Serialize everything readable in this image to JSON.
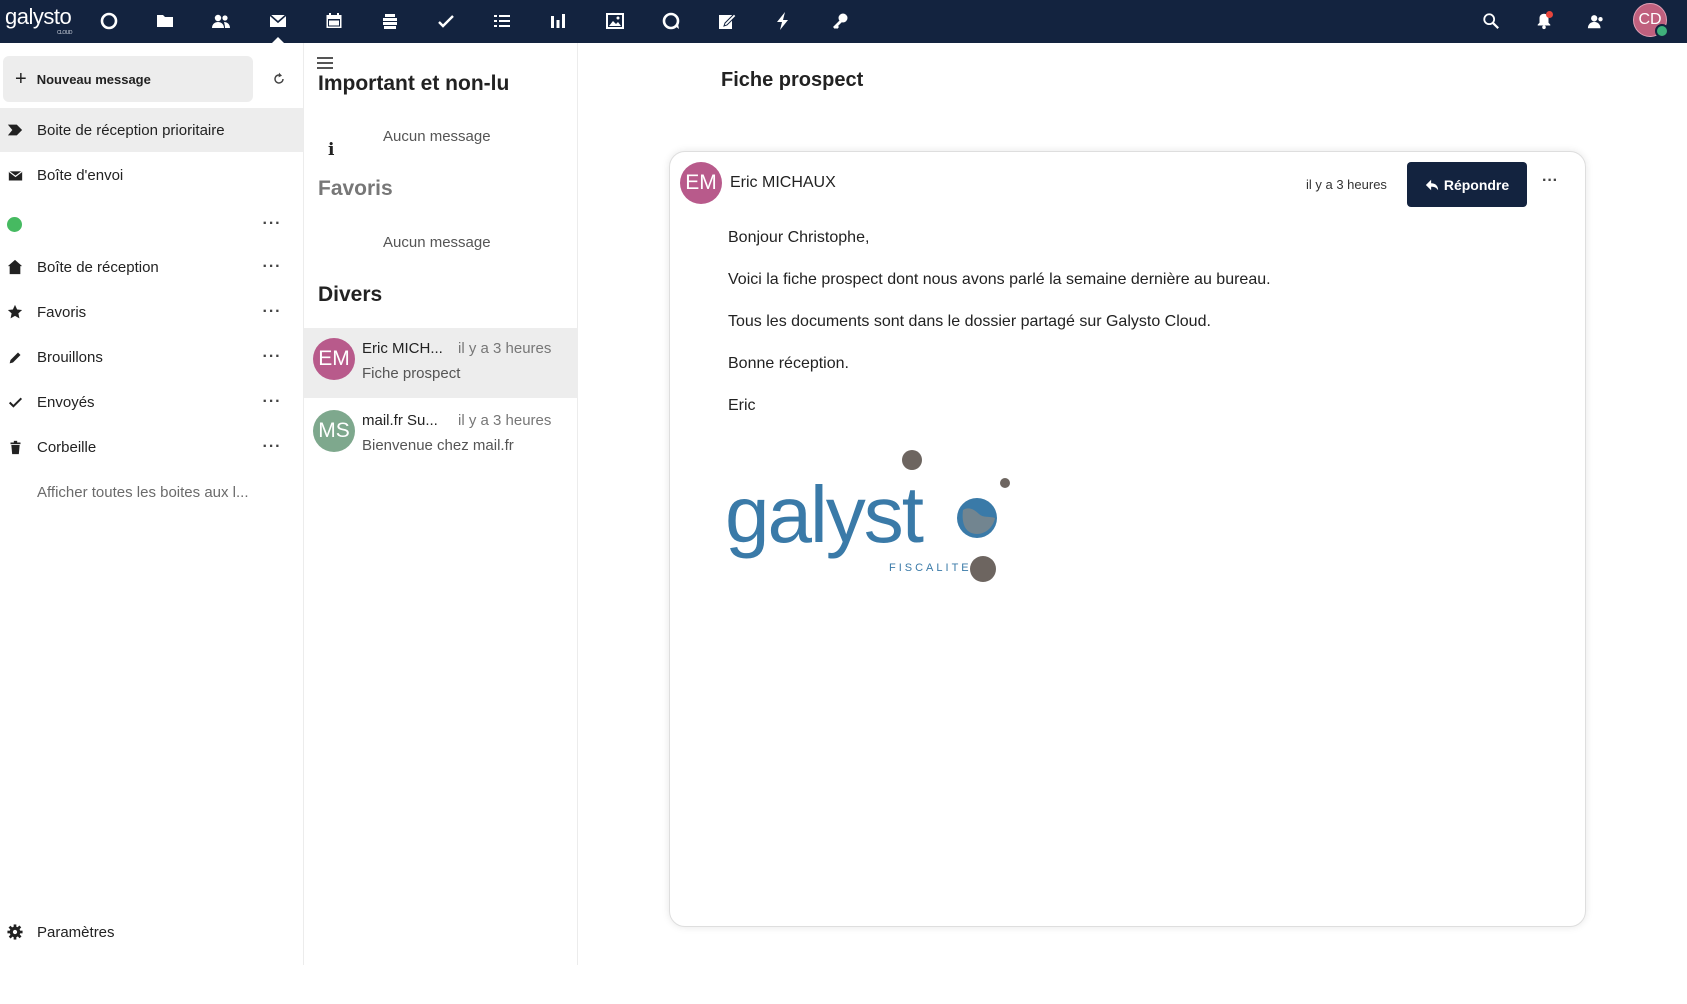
{
  "topbar": {
    "brand": "galysto",
    "brand_sub": "CLOUD",
    "apps": [
      {
        "icon": "dashboard-icon"
      },
      {
        "icon": "files-icon"
      },
      {
        "icon": "contacts-icon"
      },
      {
        "icon": "mail-icon",
        "active": true
      },
      {
        "icon": "calendar-icon"
      },
      {
        "icon": "deck-icon"
      },
      {
        "icon": "tasks-icon"
      },
      {
        "icon": "list-icon"
      },
      {
        "icon": "analytics-icon"
      },
      {
        "icon": "photos-icon"
      },
      {
        "icon": "talk-icon"
      },
      {
        "icon": "notes-icon"
      },
      {
        "icon": "activity-icon"
      },
      {
        "icon": "passwords-icon"
      }
    ],
    "user_initials": "CD",
    "accent": "#13233f"
  },
  "nav": {
    "new_message": "Nouveau message",
    "items": [
      {
        "label": "Boite de réception prioritaire",
        "icon": "priority-icon",
        "selected": true
      },
      {
        "label": "Boîte d'envoi",
        "icon": "outbox-icon"
      },
      {
        "label": "",
        "icon": "account-status-icon",
        "more": true
      },
      {
        "label": "Boîte de réception",
        "icon": "inbox-icon",
        "more": true
      },
      {
        "label": "Favoris",
        "icon": "star-icon",
        "more": true
      },
      {
        "label": "Brouillons",
        "icon": "pencil-icon",
        "more": true
      },
      {
        "label": "Envoyés",
        "icon": "check-icon",
        "more": true
      },
      {
        "label": "Corbeille",
        "icon": "trash-icon",
        "more": true
      },
      {
        "label": "Afficher toutes les boites aux l...",
        "icon": "",
        "more": false
      }
    ],
    "settings": "Paramètres"
  },
  "list": {
    "important_title": "Important et non-lu",
    "important_empty": "Aucun message",
    "favoris_title": "Favoris",
    "favoris_empty": "Aucun message",
    "divers_title": "Divers",
    "messages": [
      {
        "initials": "EM",
        "from": "Eric MICH...",
        "time": "il y a 3 heures",
        "subject": "Fiche prospect",
        "color": "#b85a8b",
        "selected": true
      },
      {
        "initials": "MS",
        "from": "mail.fr Su...",
        "time": "il y a 3 heures",
        "subject": "Bienvenue chez mail.fr",
        "color": "#7ea88d",
        "selected": false
      }
    ]
  },
  "reader": {
    "title": "Fiche prospect",
    "sender_initials": "EM",
    "sender": "Eric MICHAUX",
    "time": "il y a 3 heures",
    "reply": "Répondre",
    "body": [
      "Bonjour Christophe,",
      "Voici la fiche prospect dont nous avons parlé la semaine dernière au bureau.",
      "Tous les documents sont dans le dossier partagé sur Galysto Cloud.",
      "Bonne réception.",
      "Eric"
    ],
    "logo": {
      "word": "galyst",
      "tagline": "FISCALITE"
    }
  }
}
